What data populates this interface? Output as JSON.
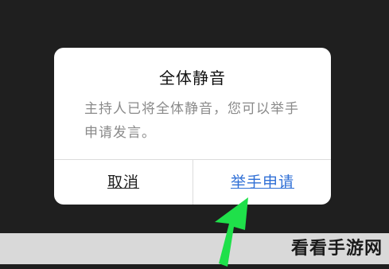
{
  "dialog": {
    "title": "全体静音",
    "message": "主持人已将全体静音，您可以举手申请发言。",
    "cancel_label": "取消",
    "raise_hand_label": "举手申请"
  },
  "watermark": {
    "text": "看看手游网"
  },
  "annotation": {
    "arrow_icon": "up-arrow-icon",
    "arrow_color": "#1fe04a"
  },
  "colors": {
    "primary_action": "#2f6fd6",
    "background": "#1f1f1f"
  }
}
